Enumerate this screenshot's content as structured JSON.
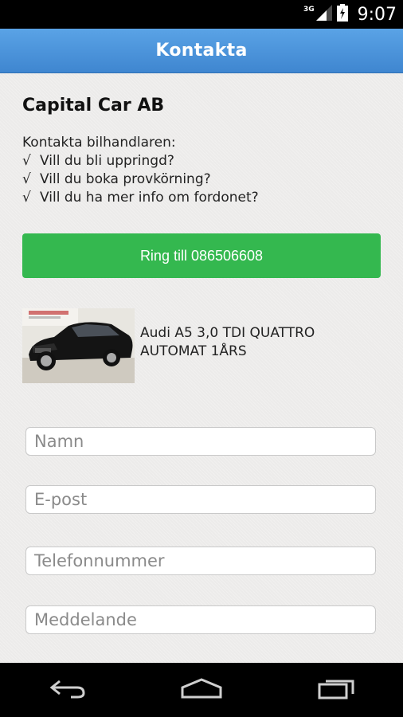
{
  "status_bar": {
    "network": "3G",
    "time": "9:07",
    "icons": [
      "network-signal-icon",
      "battery-icon"
    ]
  },
  "app_bar": {
    "title": "Kontakta"
  },
  "dealer": {
    "name": "Capital Car AB"
  },
  "intro": {
    "heading": "Kontakta bilhandlaren:",
    "check_symbol": "√",
    "items": [
      "Vill du bli uppringd?",
      "Vill du boka provkörning?",
      "Vill du ha mer info om fordonet?"
    ]
  },
  "call_button": {
    "label": "Ring till 086506608",
    "color": "#34b84f"
  },
  "car": {
    "title": "Audi A5 3,0 TDI QUATTRO AUTOMAT 1ÅRS",
    "image": "car-photo"
  },
  "form": {
    "name": {
      "placeholder": "Namn",
      "value": ""
    },
    "email": {
      "placeholder": "E-post",
      "value": ""
    },
    "phone": {
      "placeholder": "Telefonnummer",
      "value": ""
    },
    "message": {
      "placeholder": "Meddelande",
      "value": ""
    }
  },
  "nav_bar": {
    "icons": [
      "back-icon",
      "home-icon",
      "recent-apps-icon"
    ]
  },
  "colors": {
    "app_bar": "#4a94dc",
    "background": "#ecebea",
    "accent": "#34b84f"
  }
}
